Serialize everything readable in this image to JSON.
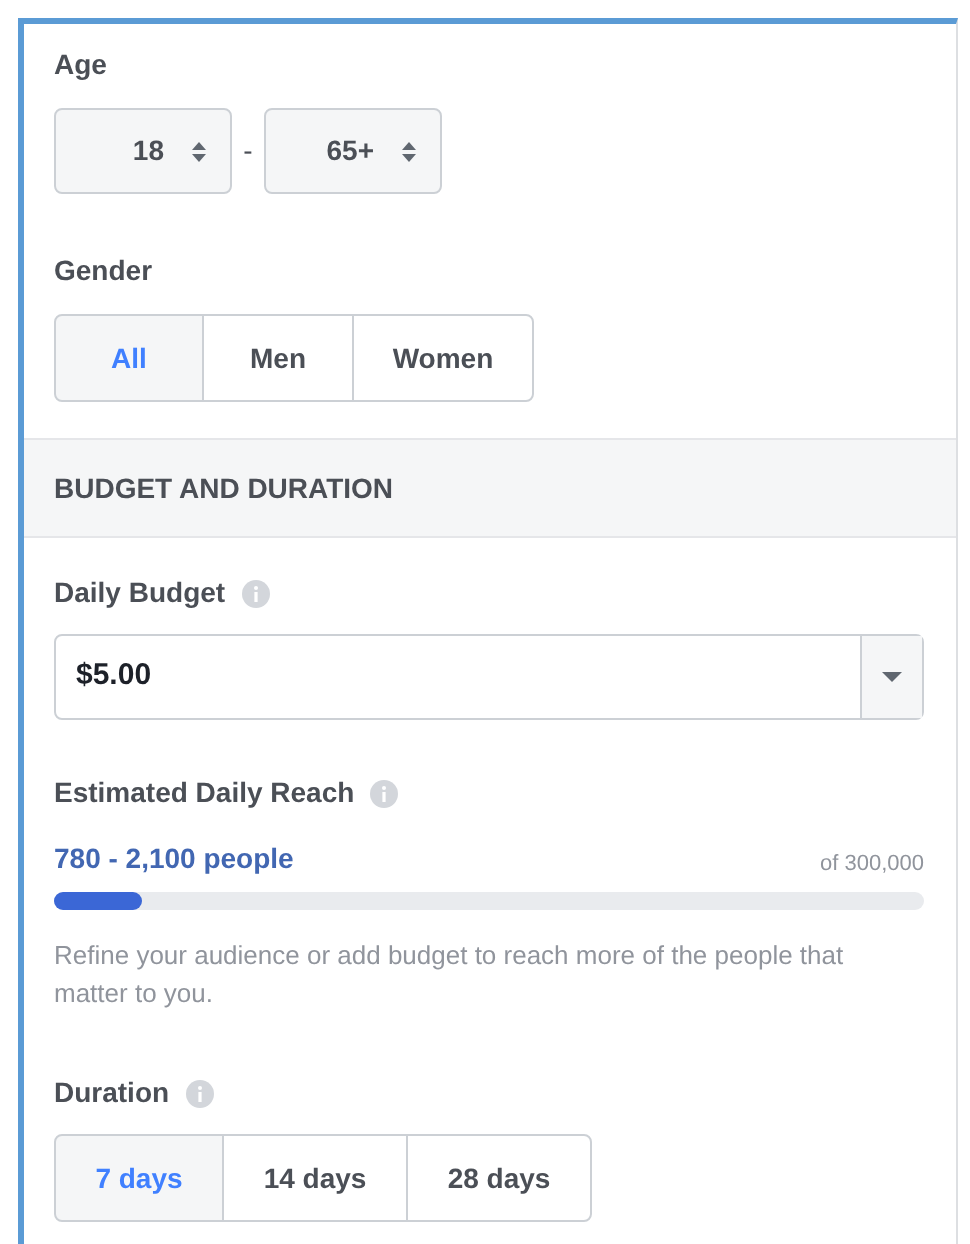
{
  "age": {
    "label": "Age",
    "min": "18",
    "separator": "-",
    "max": "65+"
  },
  "gender": {
    "label": "Gender",
    "options": [
      {
        "label": "All",
        "selected": true
      },
      {
        "label": "Men",
        "selected": false
      },
      {
        "label": "Women",
        "selected": false
      }
    ]
  },
  "section": {
    "title": "BUDGET AND DURATION"
  },
  "daily_budget": {
    "label": "Daily Budget",
    "value": "$5.00"
  },
  "reach": {
    "label": "Estimated Daily Reach",
    "range": "780 - 2,100 people",
    "total": "of 300,000",
    "level": 0.1,
    "hint": "Refine your audience or add budget to reach more of the people that matter to you."
  },
  "duration": {
    "label": "Duration",
    "options": [
      {
        "label": "7 days",
        "selected": true
      },
      {
        "label": "14 days",
        "selected": false
      },
      {
        "label": "28 days",
        "selected": false
      }
    ]
  }
}
